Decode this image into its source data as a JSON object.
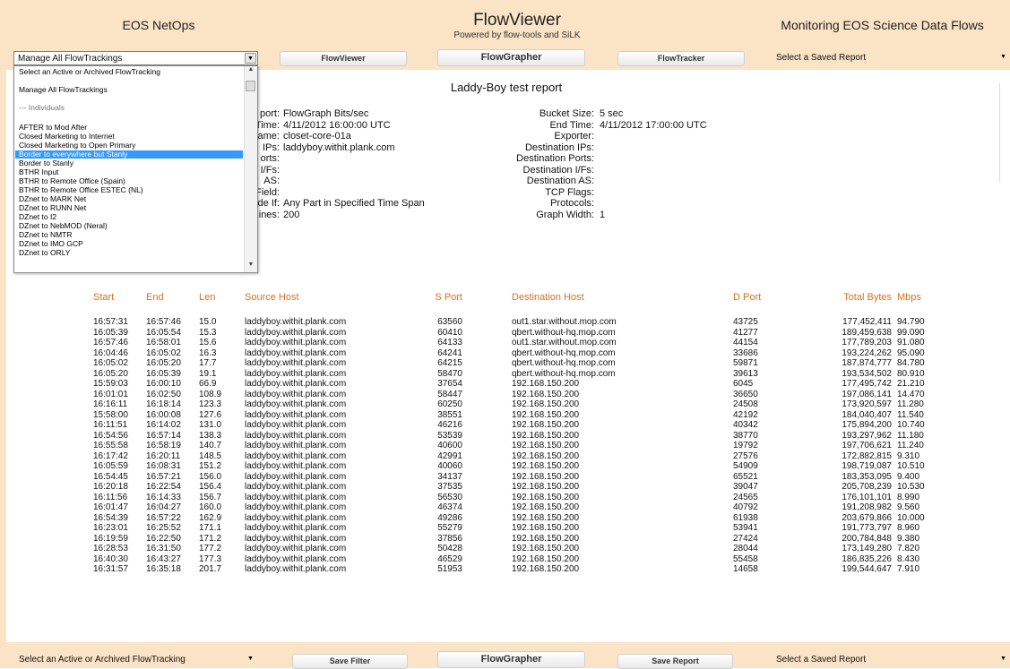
{
  "header": {
    "left_title": "EOS NetOps",
    "center_title": "FlowViewer",
    "center_subtitle": "Powered by flow-tools and SiLK",
    "right_title": "Monitoring EOS Science Data Flows"
  },
  "top_bar": {
    "tracking_select": "Manage All FlowTrackings",
    "btn_viewer": "FlowViewer",
    "btn_grapher": "FlowGrapher",
    "btn_tracker": "FlowTracker",
    "report_select": "Select a Saved Report"
  },
  "dropdown": {
    "items": [
      "Select an Active or Archived FlowTracking",
      "Manage All FlowTrackings",
      "--- Individuals",
      "AFTER to Mod After",
      "Closed Marketing to Internet",
      "Closed Marketing to Open Primary",
      "Border to everywhere but Stanly",
      "Border to Stanly",
      "BTHR Input",
      "BTHR to Remote Office (Spain)",
      "BTHR to Remote Office ESTEC (NL)",
      "DZnet to MARK Net",
      "DZnet to RUNN Net",
      "DZnet to I2",
      "DZnet to NebMOD (Neral)",
      "DZnet to NMTR",
      "DZnet to IMO GCP",
      "DZnet to ORLY"
    ]
  },
  "report": {
    "title": "Laddy-Boy test report",
    "left_fields": [
      {
        "label": "port:",
        "value": "FlowGraph Bits/sec"
      },
      {
        "label": "Time:",
        "value": "4/11/2012 16:00:00 UTC"
      },
      {
        "label": "ame:",
        "value": "closet-core-01a"
      },
      {
        "label": "IPs:",
        "value": "laddyboy.withit.plank.com"
      },
      {
        "label": "orts:",
        "value": ""
      },
      {
        "label": "I/Fs:",
        "value": ""
      },
      {
        "label": "AS:",
        "value": ""
      },
      {
        "label": "Field:",
        "value": ""
      },
      {
        "label": "de If:",
        "value": "Any Part in Specified Time Span"
      },
      {
        "label": "ines:",
        "value": "200"
      }
    ],
    "right_fields": [
      {
        "label": "Bucket Size:",
        "value": "5 sec"
      },
      {
        "label": "End Time:",
        "value": "4/11/2012 17:00:00 UTC"
      },
      {
        "label": "Exporter:",
        "value": ""
      },
      {
        "label": "Destination IPs:",
        "value": ""
      },
      {
        "label": "Destination Ports:",
        "value": ""
      },
      {
        "label": "Destination I/Fs:",
        "value": ""
      },
      {
        "label": "Destination AS:",
        "value": ""
      },
      {
        "label": "TCP Flags:",
        "value": ""
      },
      {
        "label": "Protocols:",
        "value": ""
      },
      {
        "label": "Graph Width:",
        "value": "1"
      }
    ]
  },
  "table": {
    "columns": [
      "Start",
      "End",
      "Len",
      "Source Host",
      "S Port",
      "Destination Host",
      "D Port",
      "Total Bytes",
      "Mbps"
    ],
    "rows": [
      [
        "16:57:31",
        "16:57:46",
        "15.0",
        "laddyboy.withit.plank.com",
        "63560",
        "out1.star.without.mop.com",
        "43725",
        "177,452,411",
        "94.790"
      ],
      [
        "16:05:39",
        "16:05:54",
        "15.3",
        "laddyboy.withit.plank.com",
        "60410",
        "qbert.without-hq.mop.com",
        "41277",
        "189,459,638",
        "99.090"
      ],
      [
        "16:57:46",
        "16:58:01",
        "15.6",
        "laddyboy.withit.plank.com",
        "64133",
        "out1.star.without.mop.com",
        "44154",
        "177,789,203",
        "91.080"
      ],
      [
        "16:04:46",
        "16:05:02",
        "16.3",
        "laddyboy.withit.plank.com",
        "64241",
        "qbert.without-hq.mop.com",
        "33686",
        "193,224,262",
        "95.090"
      ],
      [
        "16:05:02",
        "16:05:20",
        "17.7",
        "laddyboy.withit.plank.com",
        "64215",
        "qbert.without-hq.mop.com",
        "59871",
        "187,874,777",
        "84.780"
      ],
      [
        "16:05:20",
        "16:05:39",
        "19.1",
        "laddyboy.withit.plank.com",
        "58470",
        "qbert.without-hq.mop.com",
        "39613",
        "193,534,502",
        "80.910"
      ],
      [
        "15:59:03",
        "16:00:10",
        "66.9",
        "laddyboy.withit.plank.com",
        "37654",
        "192.168.150.200",
        "6045",
        "177,495,742",
        "21.210"
      ],
      [
        "16:01:01",
        "16:02:50",
        "108.9",
        "laddyboy.withit.plank.com",
        "58447",
        "192.168.150.200",
        "36650",
        "197,086,141",
        "14.470"
      ],
      [
        "16:16:11",
        "16:18:14",
        "123.3",
        "laddyboy.withit.plank.com",
        "60250",
        "192.168.150.200",
        "24508",
        "173,920,597",
        "11.280"
      ],
      [
        "15:58:00",
        "16:00:08",
        "127.6",
        "laddyboy.withit.plank.com",
        "38551",
        "192.168.150.200",
        "42192",
        "184,040,407",
        "11.540"
      ],
      [
        "16:11:51",
        "16:14:02",
        "131.0",
        "laddyboy.withit.plank.com",
        "46216",
        "192.168.150.200",
        "40342",
        "175,894,200",
        "10.740"
      ],
      [
        "16:54:56",
        "16:57:14",
        "138.3",
        "laddyboy.withit.plank.com",
        "53539",
        "192.168.150.200",
        "38770",
        "193,297,962",
        "11.180"
      ],
      [
        "16:55:58",
        "16:58:19",
        "140.7",
        "laddyboy.withit.plank.com",
        "40600",
        "192.168.150.200",
        "19792",
        "197,706,621",
        "11.240"
      ],
      [
        "16:17:42",
        "16:20:11",
        "148.5",
        "laddyboy.withit.plank.com",
        "42991",
        "192.168.150.200",
        "27576",
        "172,882,815",
        "9.310"
      ],
      [
        "16:05:59",
        "16:08:31",
        "151.2",
        "laddyboy.withit.plank.com",
        "40060",
        "192.168.150.200",
        "54909",
        "198,719,087",
        "10.510"
      ],
      [
        "16:54:45",
        "16:57:21",
        "156.0",
        "laddyboy.withit.plank.com",
        "34137",
        "192.168.150.200",
        "65521",
        "183,353,095",
        "9.400"
      ],
      [
        "16:20:18",
        "16:22:54",
        "156.4",
        "laddyboy.withit.plank.com",
        "37535",
        "192.168.150.200",
        "39047",
        "205,708,239",
        "10.530"
      ],
      [
        "16:11:56",
        "16:14:33",
        "156.7",
        "laddyboy.withit.plank.com",
        "56530",
        "192.168.150.200",
        "24565",
        "176,101,101",
        "8.990"
      ],
      [
        "16:01:47",
        "16:04:27",
        "160.0",
        "laddyboy.withit.plank.com",
        "46374",
        "192.168.150.200",
        "40792",
        "191,208,982",
        "9.560"
      ],
      [
        "16:54:39",
        "16:57:22",
        "162.9",
        "laddyboy.withit.plank.com",
        "49286",
        "192.168.150.200",
        "61938",
        "203,679,866",
        "10.000"
      ],
      [
        "16:23:01",
        "16:25:52",
        "171.1",
        "laddyboy.withit.plank.com",
        "55279",
        "192.168.150.200",
        "53941",
        "191,773,797",
        "8.960"
      ],
      [
        "16:19:59",
        "16:22:50",
        "171.2",
        "laddyboy.withit.plank.com",
        "37856",
        "192.168.150.200",
        "27424",
        "200,784,848",
        "9.380"
      ],
      [
        "16:28:53",
        "16:31:50",
        "177.2",
        "laddyboy.withit.plank.com",
        "50428",
        "192.168.150.200",
        "28044",
        "173,149,280",
        "7.820"
      ],
      [
        "16:40:30",
        "16:43:27",
        "177.3",
        "laddyboy.withit.plank.com",
        "46529",
        "192.168.150.200",
        "55458",
        "186,835,226",
        "8.430"
      ],
      [
        "16:31:57",
        "16:35:18",
        "201.7",
        "laddyboy.withit.plank.com",
        "51953",
        "192.168.150.200",
        "14658",
        "199,544,647",
        "7.910"
      ]
    ]
  },
  "footer": {
    "tracking_select": "Select an Active or Archived FlowTracking",
    "btn_save_filter": "Save Filter",
    "btn_grapher": "FlowGrapher",
    "btn_save_report": "Save Report",
    "report_select": "Select a Saved Report"
  },
  "colors": {
    "header_bg": "#fbe3c6",
    "column_header": "#d8711e",
    "selection": "#3399ff"
  }
}
